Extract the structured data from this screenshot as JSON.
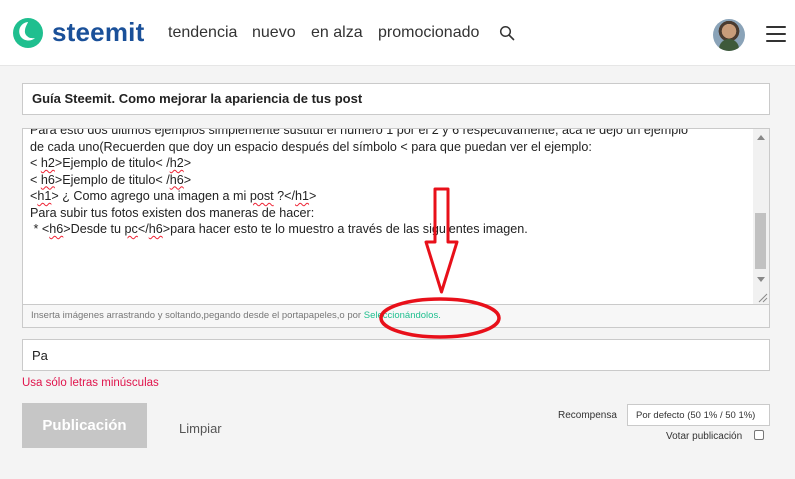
{
  "header": {
    "brand": "steemit",
    "nav": [
      "tendencia",
      "nuevo",
      "en alza",
      "promocionado"
    ],
    "icons": {
      "logo": "steemit-logo",
      "search": "search-icon",
      "menu": "hamburger-menu-icon"
    },
    "brand_color": "#1a5099",
    "logo_color": "#1fbf8f"
  },
  "editor": {
    "title_value": "Guía Steemit. Como mejorar la apariencia de tus post",
    "body_lines": [
      "Para esto dos ultimos ejemplos simplemente sustituí el número 1 por el 2 y 6 respectivamente, acá le dejo un ejemplo",
      "de cada uno(Recuerden que doy un espacio después del símbolo < para que puedan ver el ejemplo:",
      "< h2>Ejemplo de titulo< /h2>",
      "< h6>Ejemplo de titulo< /h6>",
      "",
      "",
      "<h1> ¿ Como agrego una imagen a mi post ?</h1>",
      "",
      "Para subir tus fotos existen dos maneras de hacer:",
      " * <h6>Desde tu pc</h6>para hacer esto te lo muestro a través de las siguientes imagen."
    ],
    "upload_text": "Inserta imágenes arrastrando y soltando,pegando desde el portapapeles,o por ",
    "upload_link": "Seleccionándolos.",
    "tags_value": "Pa",
    "tags_error": "Usa sólo letras minúsculas"
  },
  "actions": {
    "publish_label": "Publicación",
    "clear_label": "Limpiar",
    "reward_label": "Recompensa",
    "reward_value": "Por defecto (50 1% / 50 1%)",
    "vote_label": "Votar publicación",
    "vote_checked": false
  },
  "annotation_color": "#e8101a"
}
